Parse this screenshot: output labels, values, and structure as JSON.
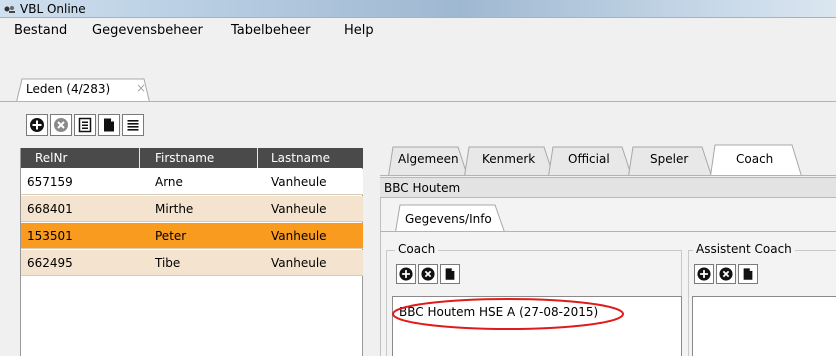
{
  "window": {
    "title": "VBL Online"
  },
  "menu": [
    "Bestand",
    "Gegevensbeheer",
    "Tabelbeheer",
    "Help"
  ],
  "doc_tab": {
    "label": "Leden (4/283)"
  },
  "toolbar": {
    "buttons": [
      "add-icon",
      "remove-icon",
      "details-icon",
      "document-icon",
      "list-icon"
    ]
  },
  "members_table": {
    "columns": [
      "RelNr",
      "Firstname",
      "Lastname"
    ],
    "rows": [
      {
        "relnr": "657159",
        "firstname": "Arne",
        "lastname": "Vanheule"
      },
      {
        "relnr": "668401",
        "firstname": "Mirthe",
        "lastname": "Vanheule"
      },
      {
        "relnr": "153501",
        "firstname": "Peter",
        "lastname": "Vanheule"
      },
      {
        "relnr": "662495",
        "firstname": "Tibe",
        "lastname": "Vanheule"
      }
    ],
    "selected_index": 2
  },
  "detail_tabs": [
    "Algemeen",
    "Kenmerk",
    "Official",
    "Speler",
    "Coach"
  ],
  "active_detail_tab": "Coach",
  "club": "BBC Houtem",
  "sub_tab": "Gegevens/Info",
  "coach_group": {
    "title": "Coach",
    "buttons": [
      "add-icon",
      "remove-icon",
      "document-icon"
    ],
    "entries": [
      "BBC Houtem HSE A (27-08-2015)"
    ]
  },
  "assistant_group": {
    "title": "Assistent Coach",
    "buttons": [
      "add-icon",
      "remove-icon",
      "document-icon"
    ]
  },
  "colors": {
    "selected_row": "#f89b1e",
    "alt_row": "#f4e4cf",
    "header": "#4a4a4a",
    "highlight_ellipse": "#e01b1b"
  }
}
